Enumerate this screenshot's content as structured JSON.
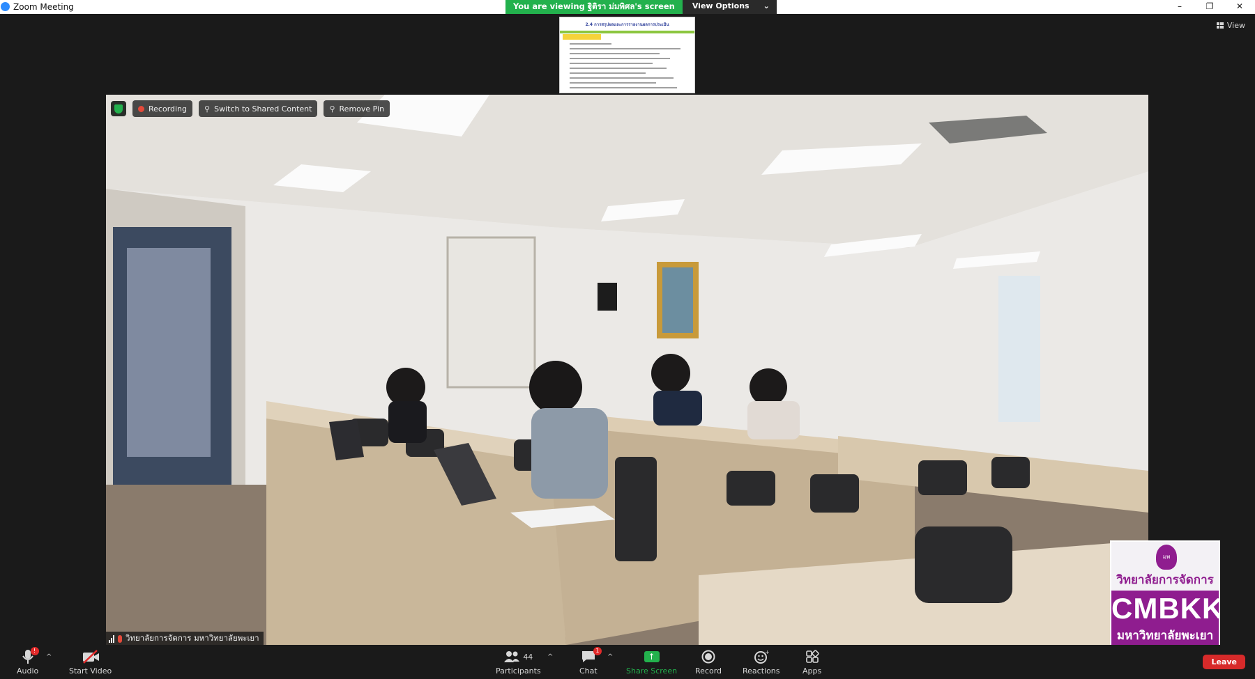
{
  "window": {
    "title": "Zoom Meeting",
    "minimize_glyph": "–",
    "restore_glyph": "❐",
    "close_glyph": "✕"
  },
  "banner": {
    "viewing_text": "You are viewing ฐิติรา ม่มพิศล's screen",
    "view_options_label": "View Options",
    "chevron": "⌄"
  },
  "view_button": {
    "label": "View"
  },
  "shared_thumb": {
    "heading": "2.4 การสรุปผลและการรายงานผลการประเมิน"
  },
  "overlay": {
    "recording_label": "Recording",
    "switch_label": "Switch to Shared Content",
    "remove_pin_label": "Remove Pin"
  },
  "participant": {
    "name": "วิทยาลัยการจัดการ มหาวิทยาลัยพะเยา"
  },
  "logo": {
    "line1": "วิทยาลัยการจัดการ",
    "line2": "CMBKK",
    "line3": "มหาวิทยาลัยพะเยา",
    "seal_text": "มพ"
  },
  "toolbar": {
    "audio_label": "Audio",
    "audio_badge": "!",
    "start_video_label": "Start Video",
    "participants_label": "Participants",
    "participants_count": "44",
    "chat_label": "Chat",
    "chat_badge": "1",
    "share_label": "Share Screen",
    "record_label": "Record",
    "reactions_label": "Reactions",
    "apps_label": "Apps",
    "leave_label": "Leave",
    "caret": "^"
  },
  "colors": {
    "accent_green": "#23b14d",
    "leave_red": "#d72a2a",
    "logo_purple": "#8f1d8f"
  }
}
